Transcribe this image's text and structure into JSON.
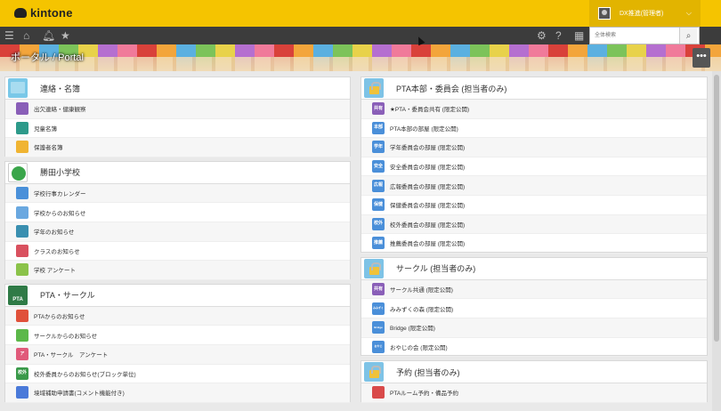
{
  "app": {
    "logo_text": "kintone"
  },
  "user": {
    "name": "DX推進(管理者)"
  },
  "nav": {
    "icons": [
      "menu-icon",
      "home-icon",
      "bell-icon",
      "star-icon"
    ],
    "right_icons": [
      "gear-icon",
      "help-icon",
      "apps-icon"
    ]
  },
  "search": {
    "placeholder": "全体検索"
  },
  "banner": {
    "title": "ポータル / Portal",
    "more_label": "•••"
  },
  "left_panels": [
    {
      "title": "連絡・名簿",
      "icon": "folder-icon",
      "items": [
        {
          "label": "出欠連絡・健康観察",
          "icon": "pen-icon",
          "color": "#8a5fb8",
          "glyph": ""
        },
        {
          "label": "児童名簿",
          "icon": "tablet-icon",
          "color": "#2d9a8a",
          "glyph": ""
        },
        {
          "label": "保護者名簿",
          "icon": "folder-icon",
          "color": "#f0b432",
          "glyph": ""
        }
      ]
    },
    {
      "title": "勝田小学校",
      "icon": "school-emblem-icon",
      "items": [
        {
          "label": "学校行事カレンダー",
          "icon": "calendar-icon",
          "color": "#4a90d9",
          "glyph": ""
        },
        {
          "label": "学校からのお知らせ",
          "icon": "megaphone-icon",
          "color": "#6aa8e0",
          "glyph": ""
        },
        {
          "label": "学年のお知らせ",
          "icon": "notebook-icon",
          "color": "#3a8fb0",
          "glyph": ""
        },
        {
          "label": "クラスのお知らせ",
          "icon": "building-icon",
          "color": "#d9515f",
          "glyph": ""
        },
        {
          "label": "学校 アンケート",
          "icon": "pencil-icon",
          "color": "#8bc34a",
          "glyph": ""
        }
      ]
    },
    {
      "title": "PTA・サークル",
      "icon": "pta-icon",
      "items": [
        {
          "label": "PTAからのお知らせ",
          "icon": "flag-icon",
          "color": "#e0513a",
          "glyph": ""
        },
        {
          "label": "サークルからのお知らせ",
          "icon": "clover-icon",
          "color": "#5cb84a",
          "glyph": ""
        },
        {
          "label": "PTA・サークル　アンケート",
          "icon": "letter-a-icon",
          "color": "#e05a7a",
          "glyph": "ア"
        },
        {
          "label": "校外委員からのお知らせ(ブロック単位)",
          "icon": "koga-icon",
          "color": "#3a9a4a",
          "glyph": "校外"
        },
        {
          "label": "境域補助申請書(コメント機能付き)",
          "icon": "document-icon",
          "color": "#4a7ad9",
          "glyph": ""
        }
      ]
    }
  ],
  "right_panels": [
    {
      "title": "PTA本部・委員会 (担当者のみ)",
      "icon": "lock-icon",
      "items": [
        {
          "label": "★PTA・委員会共有 (限定公開)",
          "icon": "kyoyu-icon",
          "color": "#8a5fb8",
          "glyph": "共有"
        },
        {
          "label": "PTA本部の部屋 (限定公開)",
          "icon": "honbu-icon",
          "color": "#4a8fd9",
          "glyph": "本部"
        },
        {
          "label": "学年委員会の部屋 (限定公開)",
          "icon": "gakunen-icon",
          "color": "#4a8fd9",
          "glyph": "学年"
        },
        {
          "label": "安全委員会の部屋 (限定公開)",
          "icon": "anzen-icon",
          "color": "#4a8fd9",
          "glyph": "安全"
        },
        {
          "label": "広報委員会の部屋 (限定公開)",
          "icon": "koho-icon",
          "color": "#4a8fd9",
          "glyph": "広報"
        },
        {
          "label": "保健委員会の部屋 (限定公開)",
          "icon": "hoken-icon",
          "color": "#4a8fd9",
          "glyph": "保健"
        },
        {
          "label": "校外委員会の部屋 (限定公開)",
          "icon": "kogai-icon",
          "color": "#4a8fd9",
          "glyph": "校外"
        },
        {
          "label": "推薦委員会の部屋 (限定公開)",
          "icon": "suisen-icon",
          "color": "#4a8fd9",
          "glyph": "推薦"
        }
      ]
    },
    {
      "title": "サークル (担当者のみ)",
      "icon": "lock-icon",
      "items": [
        {
          "label": "サークル共通 (限定公開)",
          "icon": "kyoyu-icon",
          "color": "#8a5fb8",
          "glyph": "共有"
        },
        {
          "label": "みみずくの森 (限定公開)",
          "icon": "mimizuku-icon",
          "color": "#4a8fd9",
          "glyph": "みみずく"
        },
        {
          "label": "Bridge (限定公開)",
          "icon": "bridge-icon",
          "color": "#4a8fd9",
          "glyph": "Bridge"
        },
        {
          "label": "おやじの会 (限定公開)",
          "icon": "oyaji-icon",
          "color": "#4a8fd9",
          "glyph": "おやじ"
        }
      ]
    },
    {
      "title": "予約 (担当者のみ)",
      "icon": "lock-icon",
      "items": [
        {
          "label": "PTAルーム予約・備品予約",
          "icon": "clock-icon",
          "color": "#d94a4a",
          "glyph": ""
        }
      ]
    }
  ]
}
